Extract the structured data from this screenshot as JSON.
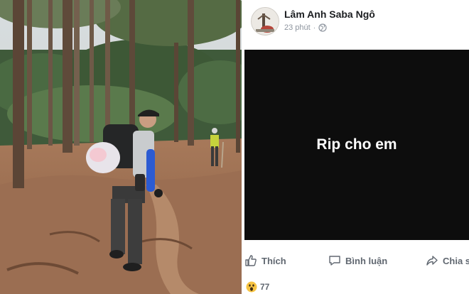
{
  "post": {
    "author": "Lâm Anh Saba Ngô",
    "time": "23 phút",
    "separator": "·",
    "text": "Rip cho em",
    "background": "#0d0d0d"
  },
  "actions": {
    "like": "Thích",
    "comment": "Bình luận",
    "share": "Chia s"
  },
  "reactions": {
    "count": "77",
    "icons": [
      "wow-reaction-icon"
    ]
  },
  "icons": {
    "privacy": "globe-icon",
    "like": "thumbs-up-icon",
    "comment": "comment-icon",
    "share": "share-icon"
  }
}
